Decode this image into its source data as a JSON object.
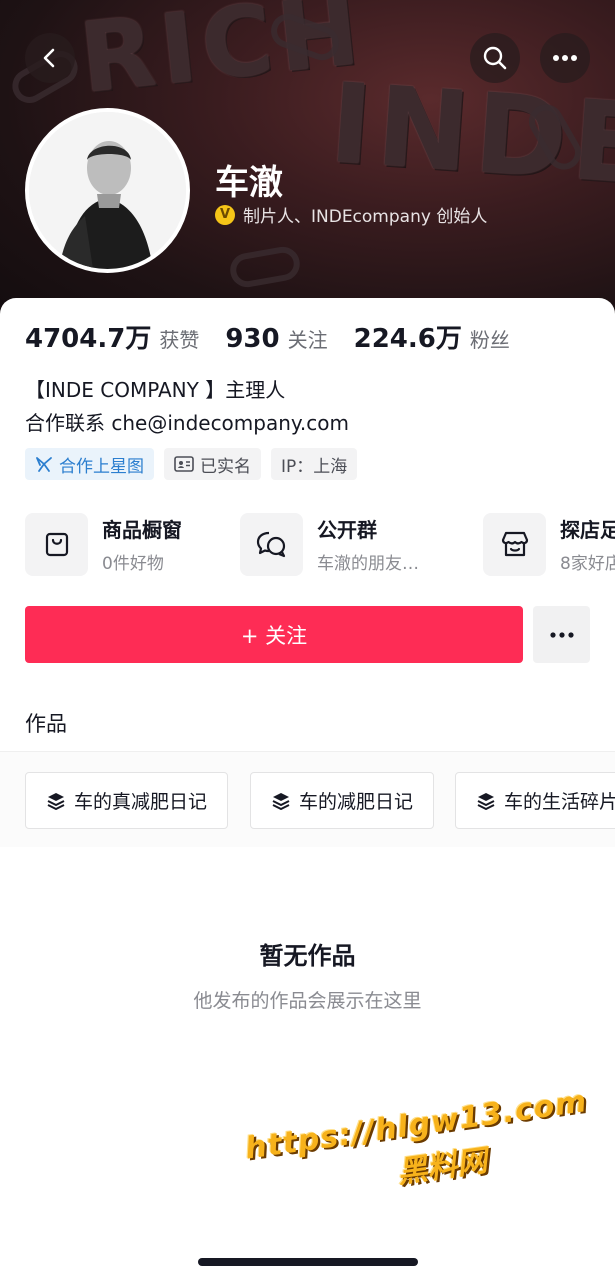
{
  "header": {
    "back_icon": "chevron-left-icon",
    "search_icon": "search-icon",
    "more_icon": "ellipsis-icon",
    "banner_text_1": "RICH",
    "banner_text_2": "INDE"
  },
  "profile": {
    "name": "车澈",
    "verification_badge": "V",
    "verification_text": "制片人、INDEcompany 创始人"
  },
  "stats": [
    {
      "value": "4704.7万",
      "label": "获赞"
    },
    {
      "value": "930",
      "label": "关注"
    },
    {
      "value": "224.6万",
      "label": "粉丝"
    }
  ],
  "bio": {
    "line1": "【INDE COMPANY 】主理人",
    "line2": "合作联系 che@indecompany.com"
  },
  "tags": [
    {
      "label": "合作上星图",
      "icon": "star-map-icon"
    },
    {
      "label": "已实名",
      "icon": "id-card-icon"
    },
    {
      "label": "IP：上海",
      "icon": ""
    }
  ],
  "services": [
    {
      "title": "商品橱窗",
      "subtitle": "0件好物",
      "icon": "shopping-bag-icon"
    },
    {
      "title": "公开群",
      "subtitle": "车澈的朋友…",
      "icon": "chat-bubbles-icon"
    },
    {
      "title": "探店足",
      "subtitle": "8家好店",
      "icon": "store-icon"
    }
  ],
  "actions": {
    "follow_label": "+ 关注",
    "more_icon": "ellipsis-icon"
  },
  "works": {
    "tab_label": "作品",
    "collections": [
      "车的真减肥日记",
      "车的减肥日记",
      "车的生活碎片"
    ],
    "empty_title": "暂无作品",
    "empty_subtitle": "他发布的作品会展示在这里"
  },
  "watermark": {
    "url": "https://hlgw13.com",
    "site": "黑料网"
  },
  "colors": {
    "accent": "#fe2c55",
    "tag_blue": "#2b7ecf",
    "verify_gold": "#f5c518",
    "watermark": "#f7b21b"
  }
}
